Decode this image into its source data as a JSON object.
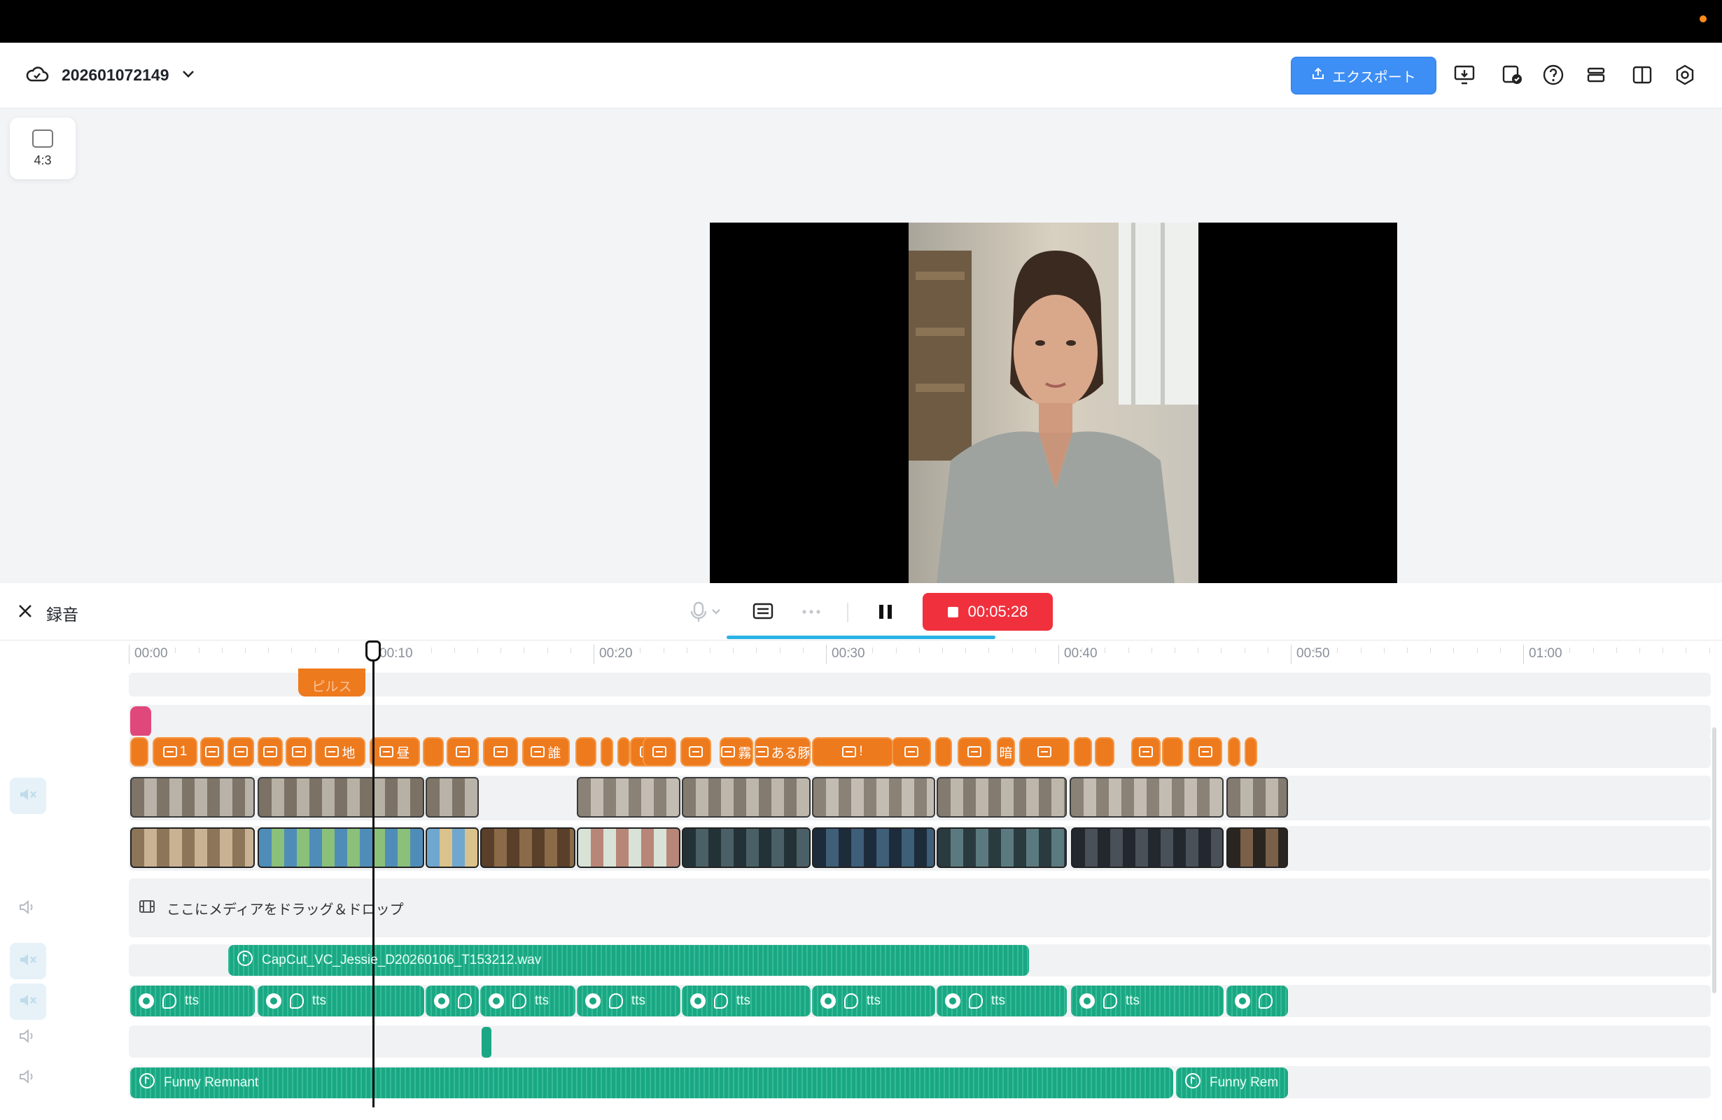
{
  "header": {
    "project_title": "202601072149",
    "export_label": "エクスポート"
  },
  "canvas": {
    "ratio_label": "4:3"
  },
  "recording": {
    "title": "録音",
    "timer": "00:05:28"
  },
  "timeline": {
    "ticks": [
      "00:00",
      "00:10",
      "00:20",
      "00:30",
      "00:40",
      "00:50",
      "01:00"
    ],
    "top_clip_label": "ピルス",
    "subtitle_chips": [
      "",
      "1",
      "",
      "",
      "",
      "",
      "地",
      "昼",
      "",
      "",
      "",
      "誰",
      "",
      "",
      "",
      "",
      "",
      "",
      "霧",
      "ある豚",
      "!",
      "",
      "",
      "",
      "暗",
      "",
      "",
      "",
      "",
      "",
      "",
      "",
      ""
    ],
    "drop_placeholder": "ここにメディアをドラッグ＆ドロップ",
    "voice_clip_label": "CapCut_VC_Jessie_D20260106_T153212.wav",
    "tts_label": "tts",
    "music_clip_label": "Funny Remnant",
    "music_clip_label_2": "Funny Rem"
  },
  "colors": {
    "accent_blue": "#3d8ef5",
    "record_red": "#f0313d",
    "subtitle_orange": "#ee7a1e",
    "audio_green": "#1aa884"
  }
}
